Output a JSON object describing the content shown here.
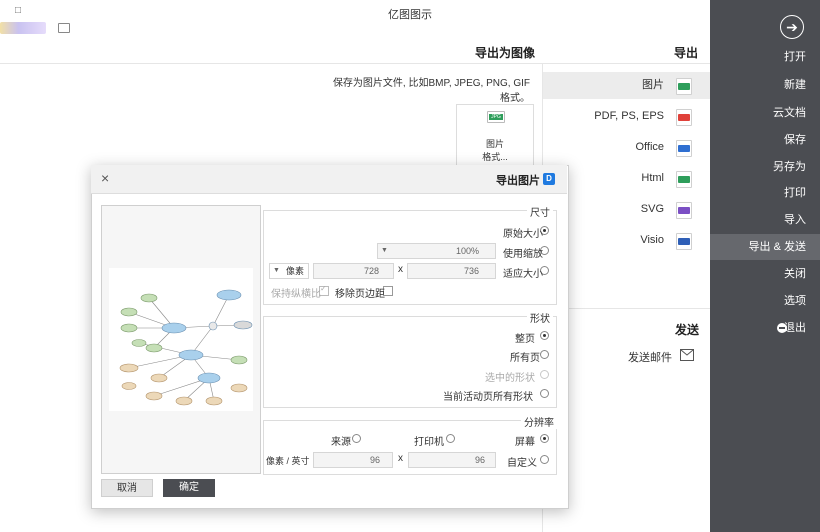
{
  "window": {
    "title": "亿图图示",
    "restore_glyph": "□"
  },
  "sidebar": {
    "back_icon": "arrow-right-circle-icon",
    "items": [
      {
        "label": "打开"
      },
      {
        "label": "新建"
      },
      {
        "label": "云文档"
      },
      {
        "label": "保存"
      },
      {
        "label": "另存为"
      },
      {
        "label": "打印"
      },
      {
        "label": "导入"
      },
      {
        "label": "导出 & 发送",
        "active": true
      },
      {
        "label": "关闭"
      },
      {
        "label": "选项"
      },
      {
        "label": "退出",
        "icon": "minus-circle-icon"
      }
    ]
  },
  "export_panel": {
    "title": "导出",
    "items": [
      {
        "label": "图片",
        "icon": "jpg-icon",
        "color": "#2e9e5b",
        "active": true
      },
      {
        "label": "PDF, PS, EPS",
        "icon": "pdf-icon",
        "color": "#e0413a"
      },
      {
        "label": "Office",
        "icon": "word-icon",
        "color": "#2f6fd1"
      },
      {
        "label": "Html",
        "icon": "html-icon",
        "color": "#2e9e5b"
      },
      {
        "label": "SVG",
        "icon": "svg-icon",
        "color": "#7b4fc4"
      },
      {
        "label": "Visio",
        "icon": "visio-icon",
        "color": "#2f5fb7"
      }
    ],
    "send_title": "发送",
    "send_item": {
      "label": "发送邮件",
      "icon": "mail-icon"
    }
  },
  "image_export": {
    "title": "导出为图像",
    "description": "保存为图片文件, 比如BMP, JPEG, PNG, GIF格式。",
    "card": {
      "badge": "JPG",
      "line1": "图片",
      "line2": "格式..."
    }
  },
  "dialog": {
    "title": "导出图片",
    "close_glyph": "×",
    "size_legend": "尺寸",
    "size_options": {
      "original": "原始大小",
      "scale": "使用缩放",
      "fit": "适应大小"
    },
    "scale_value": "100%",
    "fit_width": "736",
    "x_sep": "x",
    "fit_height": "728",
    "unit_value": "像素",
    "remove_margin_label": "移除页边距",
    "keep_ratio_label": "保持纵横比",
    "shape_legend": "形状",
    "shape_options": {
      "whole_page": "整页",
      "all_pages": "所有页",
      "selected": "选中的形状",
      "current_page_all": "当前活动页所有形状"
    },
    "resolution_legend": "分辨率",
    "res_options": {
      "screen": "屏幕",
      "printer": "打印机",
      "source": "来源",
      "custom": "自定义"
    },
    "res_x": "96",
    "res_y": "96",
    "res_unit": "像素 / 英寸",
    "ok_label": "确定",
    "cancel_label": "取消",
    "colors": {
      "ok_bg": "#4b4d52",
      "accent": "#1f7ae0"
    }
  }
}
